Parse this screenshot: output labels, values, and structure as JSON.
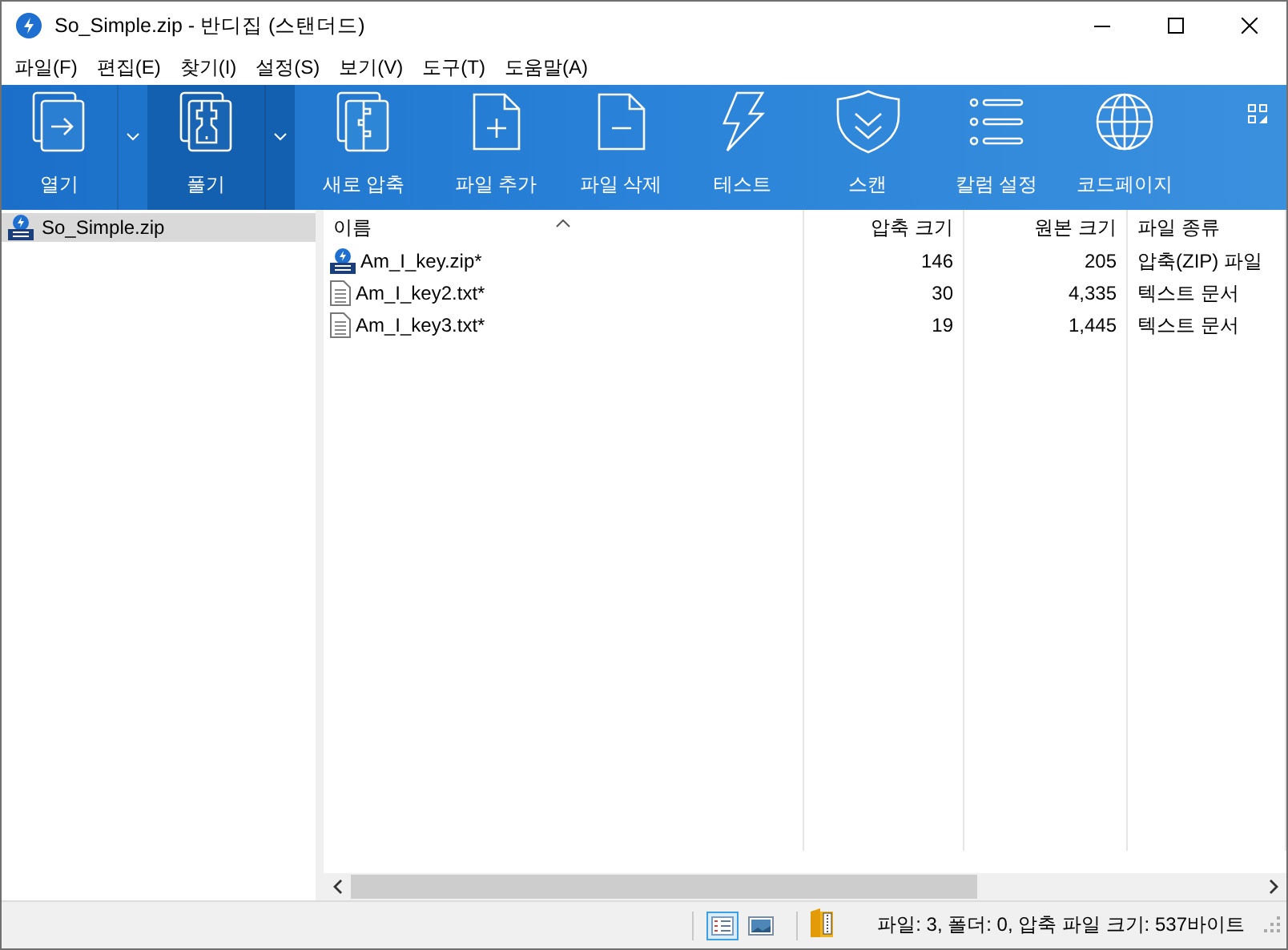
{
  "window": {
    "title": "So_Simple.zip - 반디집 (스탠더드)"
  },
  "menu": [
    "파일(F)",
    "편집(E)",
    "찾기(I)",
    "설정(S)",
    "보기(V)",
    "도구(T)",
    "도움말(A)"
  ],
  "toolbar": [
    {
      "label": "열기",
      "kind": "split",
      "selected": false
    },
    {
      "label": "풀기",
      "kind": "split",
      "selected": true
    },
    {
      "label": "새로 압축",
      "kind": "plain",
      "selected": false
    },
    {
      "label": "파일 추가",
      "kind": "plain",
      "selected": false
    },
    {
      "label": "파일 삭제",
      "kind": "plain",
      "selected": false
    },
    {
      "label": "테스트",
      "kind": "plain",
      "selected": false
    },
    {
      "label": "스캔",
      "kind": "plain",
      "selected": false
    },
    {
      "label": "칼럼 설정",
      "kind": "plain",
      "selected": false
    },
    {
      "label": "코드페이지",
      "kind": "plain",
      "selected": false
    }
  ],
  "tree": {
    "items": [
      {
        "label": "So_Simple.zip",
        "selected": true
      }
    ]
  },
  "table": {
    "columns": [
      "이름",
      "압축 크기",
      "원본 크기",
      "파일 종류"
    ],
    "rows": [
      {
        "kind": "zip",
        "cells": [
          "Am_I_key.zip*",
          "146",
          "205",
          "압축(ZIP) 파일"
        ]
      },
      {
        "kind": "text",
        "cells": [
          "Am_I_key2.txt*",
          "30",
          "4,335",
          "텍스트 문서"
        ]
      },
      {
        "kind": "text",
        "cells": [
          "Am_I_key3.txt*",
          "19",
          "1,445",
          "텍스트 문서"
        ]
      }
    ]
  },
  "status_bar": {
    "views": [
      {
        "kind": "details",
        "selected": true
      },
      {
        "kind": "thumbnails",
        "selected": false
      }
    ],
    "text": "파일: 3, 폴더: 0, 압축 파일 크기: 537바이트"
  }
}
